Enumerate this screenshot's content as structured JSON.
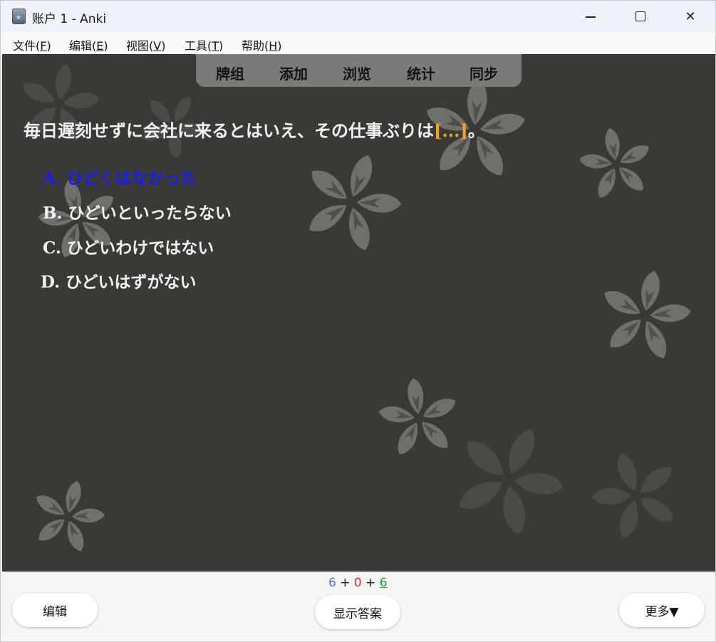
{
  "window": {
    "title": "账户 1 - Anki"
  },
  "menu": [
    {
      "label": "文件(",
      "key": "F",
      "suffix": ")"
    },
    {
      "label": "编辑(",
      "key": "E",
      "suffix": ")"
    },
    {
      "label": "视图(",
      "key": "V",
      "suffix": ")"
    },
    {
      "label": "工具(",
      "key": "T",
      "suffix": ")"
    },
    {
      "label": "帮助(",
      "key": "H",
      "suffix": ")"
    }
  ],
  "nav": [
    "牌组",
    "添加",
    "浏览",
    "统计",
    "同步"
  ],
  "card": {
    "question_text": "毎日遅刻せずに会社に来るとはいえ、その仕事ぶりは",
    "cloze": "[...]",
    "question_end": "。",
    "options": [
      "A. ひどくはなかった",
      "B. ひどいといったらない",
      "C. ひどいわけではない",
      "D. ひどいはずがない"
    ],
    "selected_option_index": 0
  },
  "counts": {
    "new": "6",
    "plus1": "+",
    "learning": "0",
    "plus2": "+",
    "review": "6"
  },
  "buttons": {
    "edit": "编辑",
    "show_answer": "显示答案",
    "more": "更多▼"
  },
  "colors": {
    "card_background": "#393a36",
    "cloze": "#f0a030",
    "selected_option": "#1a1aff",
    "count_new": "#4a7ae8",
    "count_learning": "#d03030",
    "count_review": "#2e9a3e"
  }
}
